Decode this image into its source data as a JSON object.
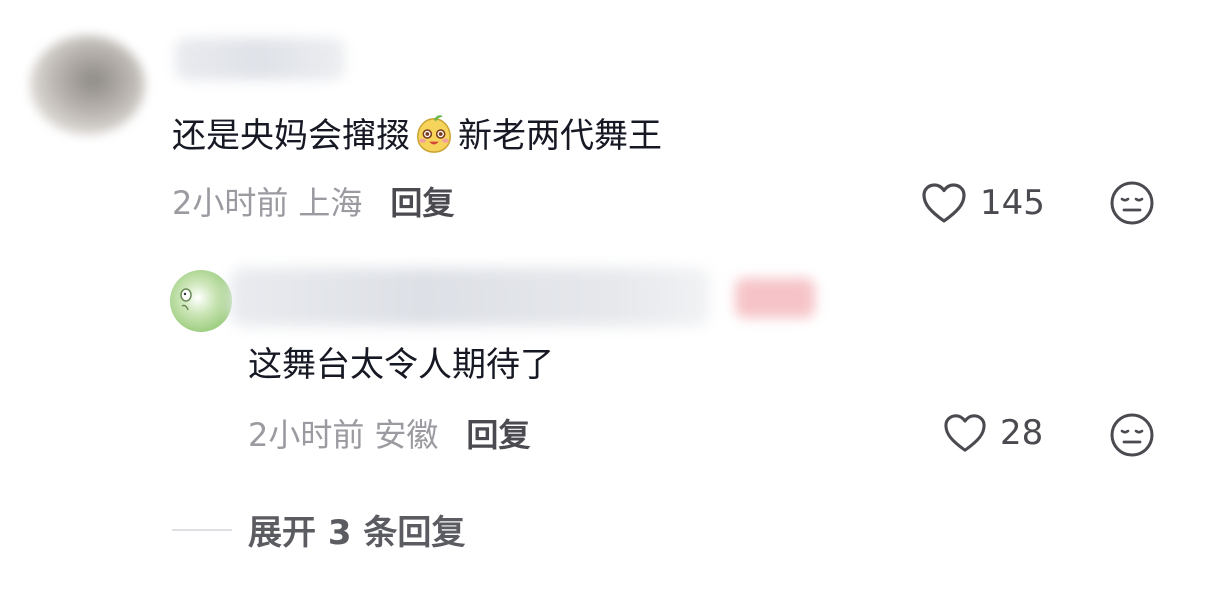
{
  "comment": {
    "text_before_emoji": "还是央妈会撺掇",
    "emoji": "smiling-chestnut-emoji",
    "text_after_emoji": "新老两代舞王",
    "time": "2小时前",
    "location": "上海",
    "reply_label": "回复",
    "likes": "145"
  },
  "reply": {
    "text": "这舞台太令人期待了",
    "time": "2小时前",
    "location": "安徽",
    "reply_label": "回复",
    "likes": "28"
  },
  "expand": {
    "label": "展开 3 条回复"
  },
  "colors": {
    "text_primary": "#161823",
    "text_secondary": "#9a9aa0",
    "action": "#4a4a50"
  },
  "icons": {
    "like": "heart-outline-icon",
    "dislike": "neutral-face-icon"
  }
}
